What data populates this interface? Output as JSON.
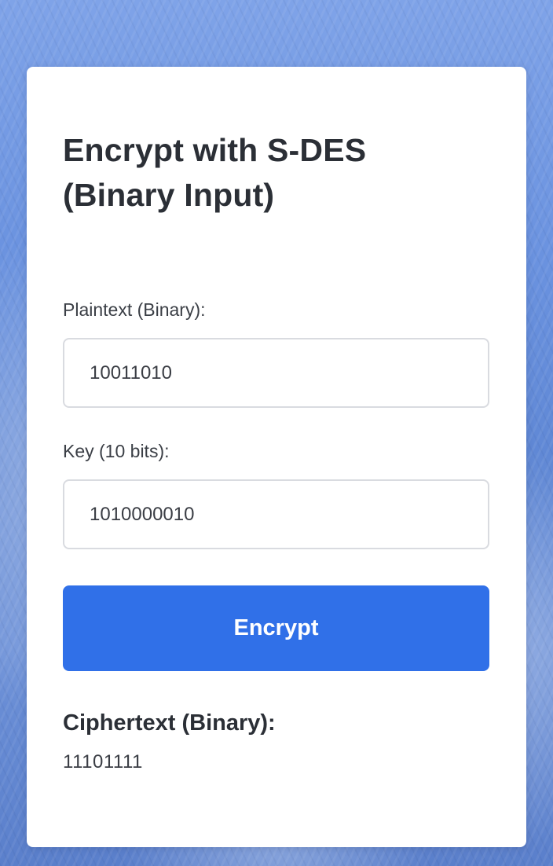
{
  "card": {
    "title": "Encrypt with S-DES\n(Binary Input)"
  },
  "form": {
    "plaintext_label": "Plaintext (Binary):",
    "plaintext_value": "10011010",
    "key_label": "Key (10 bits):",
    "key_value": "1010000010",
    "encrypt_label": "Encrypt"
  },
  "result": {
    "heading": "Ciphertext (Binary):",
    "value": "11101111"
  },
  "colors": {
    "accent": "#3070e8",
    "background": "#6a92df",
    "card": "#ffffff"
  }
}
